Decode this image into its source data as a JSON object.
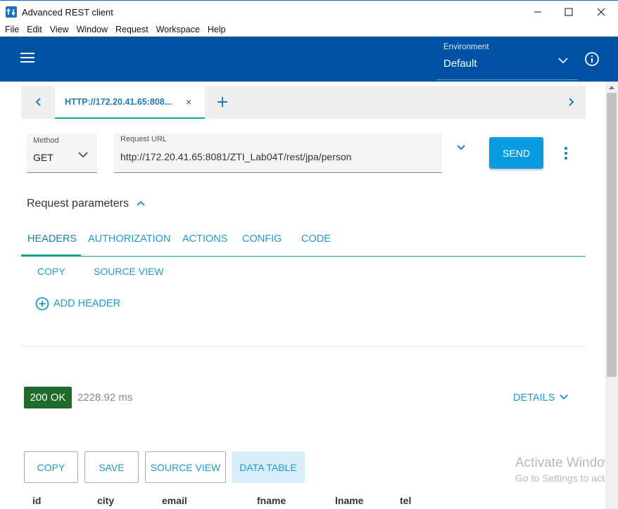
{
  "window": {
    "title": "Advanced REST client"
  },
  "menu": [
    "File",
    "Edit",
    "View",
    "Window",
    "Request",
    "Workspace",
    "Help"
  ],
  "environment": {
    "label": "Environment",
    "value": "Default"
  },
  "request_tab": {
    "label": "HTTP://172.20.41.65:808...",
    "close": "×"
  },
  "method": {
    "label": "Method",
    "value": "GET"
  },
  "url": {
    "label": "Request URL",
    "value": "http://172.20.41.65:8081/ZTI_Lab04T/rest/jpa/person"
  },
  "send_label": "SEND",
  "params": {
    "title": "Request parameters",
    "tabs": [
      "HEADERS",
      "AUTHORIZATION",
      "ACTIONS",
      "CONFIG",
      "CODE"
    ],
    "copy": "COPY",
    "source_view": "SOURCE VIEW",
    "add_header": "ADD HEADER"
  },
  "response": {
    "status": "200 OK",
    "time": "2228.92 ms",
    "details": "DETAILS",
    "actions": [
      "COPY",
      "SAVE",
      "SOURCE VIEW",
      "DATA TABLE"
    ],
    "columns": [
      "id",
      "city",
      "email",
      "fname",
      "lname",
      "tel"
    ]
  },
  "watermark": {
    "line1": "Activate Windows",
    "line2": "Go to Settings to activate Windows."
  },
  "colors": {
    "header_bg": "#0052a4",
    "accent": "#1f9ac9",
    "send_bg": "#0a9ce0",
    "status_ok": "#1e6b2c",
    "tab_underline": "#16a085"
  }
}
